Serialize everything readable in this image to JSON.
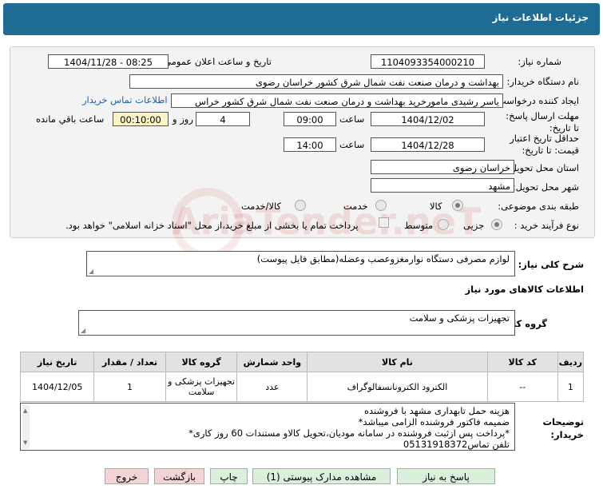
{
  "header": {
    "title": "جزئیات اطلاعات نیاز"
  },
  "form": {
    "need_number_label": "شماره نیاز:",
    "need_number": "1104093354000210",
    "announce_label": "تاریخ و ساعت اعلان عمومی:",
    "announce_value": "1404/11/28 - 08:25",
    "buyer_org_label": "نام دستگاه خریدار:",
    "buyer_org": "بهداشت و درمان صنعت نفت شمال شرق کشور   خراسان رضوی",
    "requester_label": "ایجاد کننده درخواست:",
    "requester": "یاسر رشیدی مامورخرید بهداشت و درمان صنعت نفت شمال شرق کشور  خراس",
    "contact_link": "اطلاعات تماس خریدار",
    "send_deadline_label": "مهلت ارسال پاسخ: تا تاریخ:",
    "send_date": "1404/12/02",
    "time_label": "ساعت",
    "send_time": "09:00",
    "days": "4",
    "days_label": "روز و",
    "remaining": "00:10:00",
    "remaining_label": "ساعت باقي مانده",
    "validity_label": "حداقل تاریخ اعتبار قیمت: تا تاریخ:",
    "validity_date": "1404/12/28",
    "validity_time": "14:00",
    "province_label": "استان محل تحویل:",
    "province": "خراسان رضوی",
    "city_label": "شهر محل تحویل:",
    "city": "مشهد",
    "category_label": "طبقه بندی موضوعی:",
    "category_options": [
      "کالا",
      "خدمت",
      "کالا/خدمت"
    ],
    "process_label": "نوع فرآیند خرید :",
    "process_options": [
      "جزیی",
      "متوسط"
    ],
    "payment_note": "پرداخت تمام یا بخشی از مبلغ خرید،از محل \"اسناد خزانه اسلامی\" خواهد بود."
  },
  "description": {
    "label": "شرح کلی نیاز:",
    "value": "لوازم مصرفی دستگاه نوارمغزوعصب وعضله(مطابق فایل پیوست)"
  },
  "goods_info": {
    "title": "اطلاعات کالاهای مورد نیاز",
    "group_label": "گروه کالا:",
    "group_value": "تجهیزات پزشکی و سلامت"
  },
  "table": {
    "headers": [
      "ردیف",
      "کد کالا",
      "نام کالا",
      "واحد شمارش",
      "گروه کالا",
      "تعداد / مقدار",
      "تاریخ نیاز"
    ],
    "rows": [
      {
        "row": "1",
        "code": "--",
        "name": "الکترود الکترونانسفالوگراف",
        "unit": "عدد",
        "group": "تجهیزات پزشکی و سلامت",
        "qty": "1",
        "date": "1404/12/05"
      }
    ]
  },
  "buyer_notes": {
    "label": "توضیحات خریدار:",
    "lines": [
      "هزینه حمل تابهداری مشهد با فروشنده",
      "ضمیمه فاکتور فروشنده الزامی میباشد*",
      "*پرداخت پس ازثبت فروشنده در سامانه مودیان،تحویل کالاو مستندات 60 روز کاری*",
      "تلفن تماس05131918372"
    ]
  },
  "buttons": {
    "reply": "پاسخ به نیاز",
    "view_docs": "مشاهده مدارک پیوستی (1)",
    "print": "چاپ",
    "back": "بازگشت",
    "exit": "خروج"
  },
  "watermark": "AriaTender.neT",
  "colors": {
    "header": "#1e6c93",
    "link": "#2360b0",
    "green_button": "#dbf0db",
    "red_button": "#f3d3d3",
    "remaining_bg": "#fdf4c5"
  }
}
